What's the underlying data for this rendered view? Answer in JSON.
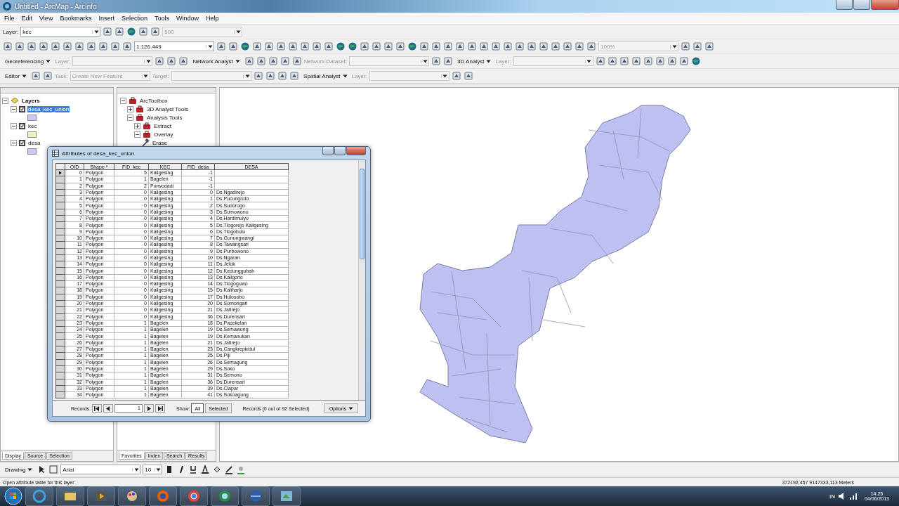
{
  "window": {
    "title": "Untitled - ArcMap - ArcInfo"
  },
  "menu": [
    "File",
    "Edit",
    "View",
    "Bookmarks",
    "Insert",
    "Selection",
    "Tools",
    "Window",
    "Help"
  ],
  "toolbars": [
    [
      {
        "kind": "label",
        "text": "Layer:",
        "disabled": false
      },
      {
        "kind": "combo",
        "text": "kec",
        "disabled": false
      },
      {
        "kind": "icon"
      },
      {
        "kind": "icon"
      },
      {
        "kind": "round"
      },
      {
        "kind": "icon"
      },
      {
        "kind": "icon"
      },
      {
        "kind": "combo",
        "text": "500",
        "disabled": true
      }
    ],
    [
      {
        "kind": "icon"
      },
      {
        "kind": "icon"
      },
      {
        "kind": "icon"
      },
      {
        "kind": "icon"
      },
      {
        "kind": "icon"
      },
      {
        "kind": "icon"
      },
      {
        "kind": "icon"
      },
      {
        "kind": "icon"
      },
      {
        "kind": "icon"
      },
      {
        "kind": "icon"
      },
      {
        "kind": "icon"
      },
      {
        "kind": "combo",
        "text": "1:126.449",
        "disabled": false
      },
      {
        "kind": "icon"
      },
      {
        "kind": "icon"
      },
      {
        "kind": "round"
      },
      {
        "kind": "icon"
      },
      {
        "kind": "icon"
      },
      {
        "kind": "icon"
      },
      {
        "kind": "icon"
      },
      {
        "kind": "icon"
      },
      {
        "kind": "icon"
      },
      {
        "kind": "icon"
      },
      {
        "kind": "round"
      },
      {
        "kind": "round"
      },
      {
        "kind": "icon"
      },
      {
        "kind": "icon"
      },
      {
        "kind": "icon"
      },
      {
        "kind": "icon"
      },
      {
        "kind": "round"
      },
      {
        "kind": "icon"
      },
      {
        "kind": "icon"
      },
      {
        "kind": "icon"
      },
      {
        "kind": "icon"
      },
      {
        "kind": "icon"
      },
      {
        "kind": "icon"
      },
      {
        "kind": "icon"
      },
      {
        "kind": "icon"
      },
      {
        "kind": "icon"
      },
      {
        "kind": "icon"
      },
      {
        "kind": "icon"
      },
      {
        "kind": "icon"
      },
      {
        "kind": "icon"
      },
      {
        "kind": "icon"
      },
      {
        "kind": "icon"
      },
      {
        "kind": "combo",
        "text": "100%",
        "disabled": true
      },
      {
        "kind": "icon"
      },
      {
        "kind": "icon"
      },
      {
        "kind": "icon"
      }
    ],
    [
      {
        "kind": "menu",
        "text": "Georeferencing",
        "disabled": false
      },
      {
        "kind": "label",
        "text": "Layer:",
        "disabled": true
      },
      {
        "kind": "combo",
        "disabled": true
      },
      {
        "kind": "icon"
      },
      {
        "kind": "icon"
      },
      {
        "kind": "icon"
      },
      {
        "kind": "menu",
        "text": "Network Analyst",
        "disabled": false
      },
      {
        "kind": "icon"
      },
      {
        "kind": "icon"
      },
      {
        "kind": "icon"
      },
      {
        "kind": "icon"
      },
      {
        "kind": "icon"
      },
      {
        "kind": "label",
        "text": "Network Dataset:",
        "disabled": true
      },
      {
        "kind": "combo",
        "disabled": true
      },
      {
        "kind": "icon"
      },
      {
        "kind": "icon"
      },
      {
        "kind": "menu",
        "text": "3D Analyst",
        "disabled": false
      },
      {
        "kind": "label",
        "text": "Layer:",
        "disabled": true
      },
      {
        "kind": "combo",
        "disabled": true
      },
      {
        "kind": "icon"
      },
      {
        "kind": "icon"
      },
      {
        "kind": "icon"
      },
      {
        "kind": "icon"
      },
      {
        "kind": "icon"
      },
      {
        "kind": "icon"
      },
      {
        "kind": "icon"
      },
      {
        "kind": "icon"
      },
      {
        "kind": "round"
      }
    ],
    [
      {
        "kind": "menu",
        "text": "Editor",
        "disabled": false
      },
      {
        "kind": "icon"
      },
      {
        "kind": "icon"
      },
      {
        "kind": "label",
        "text": "Task:",
        "disabled": true
      },
      {
        "kind": "combo",
        "text": "Create New Feature",
        "disabled": true
      },
      {
        "kind": "label",
        "text": "Target:",
        "disabled": true
      },
      {
        "kind": "combo",
        "disabled": true
      },
      {
        "kind": "icon"
      },
      {
        "kind": "icon"
      },
      {
        "kind": "icon"
      },
      {
        "kind": "icon"
      },
      {
        "kind": "menu",
        "text": "Spatial Analyst",
        "disabled": false
      },
      {
        "kind": "label",
        "text": "Layer:",
        "disabled": true
      },
      {
        "kind": "combo",
        "disabled": true
      },
      {
        "kind": "icon"
      },
      {
        "kind": "icon"
      }
    ]
  ],
  "toc": {
    "root": "Layers",
    "layers": [
      {
        "name": "desa_kec_union",
        "checked": true,
        "selected": true,
        "color": "#c8c8f0"
      },
      {
        "name": "kec",
        "checked": true,
        "selected": false,
        "color": "#f0f0c0"
      },
      {
        "name": "desa",
        "checked": true,
        "selected": false,
        "color": "#c8c8f0"
      }
    ],
    "tabs": [
      {
        "label": "Display",
        "selected": true
      },
      {
        "label": "Source",
        "selected": false
      },
      {
        "label": "Selection",
        "selected": false
      }
    ]
  },
  "toolbox": {
    "tree": [
      {
        "label": "ArcToolbox",
        "expanded": true,
        "children": [
          {
            "label": "3D Analyst Tools",
            "expanded": false
          },
          {
            "label": "Analysis Tools",
            "expanded": true,
            "children": [
              {
                "label": "Extract",
                "expanded": false
              },
              {
                "label": "Overlay",
                "expanded": true,
                "children": [
                  {
                    "label": "Erase"
                  }
                ]
              }
            ]
          }
        ]
      }
    ],
    "tabs": [
      {
        "label": "Favorites",
        "selected": true
      },
      {
        "label": "Index",
        "selected": false
      },
      {
        "label": "Search",
        "selected": false
      },
      {
        "label": "Results",
        "selected": false
      }
    ]
  },
  "attribute_table": {
    "title": "Attributes of desa_kec_union",
    "columns": [
      "OID",
      "Shape *",
      "FID_kec",
      "KEC",
      "FID_desa",
      "DESA"
    ],
    "rows": [
      {
        "current": true,
        "cells": [
          "0",
          "Polygon",
          "5",
          "Kaligesing",
          "-1",
          ""
        ]
      },
      {
        "current": false,
        "cells": [
          "1",
          "Polygon",
          "1",
          "Bagelen",
          "-1",
          ""
        ]
      },
      {
        "current": false,
        "cells": [
          "2",
          "Polygon",
          "2",
          "Purwodadi",
          "-1",
          ""
        ]
      },
      {
        "current": false,
        "cells": [
          "3",
          "Polygon",
          "0",
          "Kaligesing",
          "0",
          "Ds.Ngadirejo"
        ]
      },
      {
        "current": false,
        "cells": [
          "4",
          "Polygon",
          "0",
          "Kaligesing",
          "1",
          "Ds.Pucungroto"
        ]
      },
      {
        "current": false,
        "cells": [
          "5",
          "Polygon",
          "0",
          "Kaligesing",
          "2",
          "Ds.Sudorogo"
        ]
      },
      {
        "current": false,
        "cells": [
          "6",
          "Polygon",
          "0",
          "Kaligesing",
          "3",
          "Ds.Sumowono"
        ]
      },
      {
        "current": false,
        "cells": [
          "7",
          "Polygon",
          "0",
          "Kaligesing",
          "4",
          "Ds.Hardimulyo"
        ]
      },
      {
        "current": false,
        "cells": [
          "8",
          "Polygon",
          "0",
          "Kaligesing",
          "5",
          "Ds.Tlogorejo Kaligesing"
        ]
      },
      {
        "current": false,
        "cells": [
          "9",
          "Polygon",
          "0",
          "Kaligesing",
          "6",
          "Ds.Tlogobulu"
        ]
      },
      {
        "current": false,
        "cells": [
          "10",
          "Polygon",
          "0",
          "Kaligesing",
          "7",
          "Ds.Gunungwangi"
        ]
      },
      {
        "current": false,
        "cells": [
          "11",
          "Polygon",
          "0",
          "Kaligesing",
          "8",
          "Ds.Tawangsari"
        ]
      },
      {
        "current": false,
        "cells": [
          "12",
          "Polygon",
          "0",
          "Kaligesing",
          "9",
          "Ds.Purbowono"
        ]
      },
      {
        "current": false,
        "cells": [
          "13",
          "Polygon",
          "0",
          "Kaligesing",
          "10",
          "Ds.Ngaran"
        ]
      },
      {
        "current": false,
        "cells": [
          "14",
          "Polygon",
          "0",
          "Kaligesing",
          "11",
          "Ds.Jelok"
        ]
      },
      {
        "current": false,
        "cells": [
          "15",
          "Polygon",
          "0",
          "Kaligesing",
          "12",
          "Ds.Kedunggubah"
        ]
      },
      {
        "current": false,
        "cells": [
          "16",
          "Polygon",
          "0",
          "Kaligesing",
          "13",
          "Ds.Kaligono"
        ]
      },
      {
        "current": false,
        "cells": [
          "17",
          "Polygon",
          "0",
          "Kaligesing",
          "14",
          "Ds.Tlogoguwo"
        ]
      },
      {
        "current": false,
        "cells": [
          "18",
          "Polygon",
          "0",
          "Kaligesing",
          "15",
          "Ds.Kaliharjo"
        ]
      },
      {
        "current": false,
        "cells": [
          "19",
          "Polygon",
          "0",
          "Kaligesing",
          "17",
          "Ds.Hulosobo"
        ]
      },
      {
        "current": false,
        "cells": [
          "20",
          "Polygon",
          "0",
          "Kaligesing",
          "20",
          "Ds.Somongari"
        ]
      },
      {
        "current": false,
        "cells": [
          "21",
          "Polygon",
          "0",
          "Kaligesing",
          "21",
          "Ds.Jatirejo"
        ]
      },
      {
        "current": false,
        "cells": [
          "22",
          "Polygon",
          "0",
          "Kaligesing",
          "36",
          "Ds.Durensari"
        ]
      },
      {
        "current": false,
        "cells": [
          "23",
          "Polygon",
          "1",
          "Bagelen",
          "18",
          "Ds.Pacekelan"
        ]
      },
      {
        "current": false,
        "cells": [
          "24",
          "Polygon",
          "1",
          "Bagelen",
          "19",
          "Ds.Semawung"
        ]
      },
      {
        "current": false,
        "cells": [
          "25",
          "Polygon",
          "1",
          "Bagelen",
          "19",
          "Ds.Kemanukan"
        ]
      },
      {
        "current": false,
        "cells": [
          "26",
          "Polygon",
          "1",
          "Bagelen",
          "21",
          "Ds.Jatirejo"
        ]
      },
      {
        "current": false,
        "cells": [
          "27",
          "Polygon",
          "1",
          "Bagelen",
          "23",
          "Ds.Cangkrepkidul"
        ]
      },
      {
        "current": false,
        "cells": [
          "28",
          "Polygon",
          "1",
          "Bagelen",
          "25",
          "Ds.Piji"
        ]
      },
      {
        "current": false,
        "cells": [
          "29",
          "Polygon",
          "1",
          "Bagelen",
          "26",
          "Ds.Semagung"
        ]
      },
      {
        "current": false,
        "cells": [
          "30",
          "Polygon",
          "1",
          "Bagelen",
          "29",
          "Ds.Soko"
        ]
      },
      {
        "current": false,
        "cells": [
          "31",
          "Polygon",
          "1",
          "Bagelen",
          "31",
          "Ds.Semono"
        ]
      },
      {
        "current": false,
        "cells": [
          "32",
          "Polygon",
          "1",
          "Bagelen",
          "36",
          "Ds.Durensari"
        ]
      },
      {
        "current": false,
        "cells": [
          "33",
          "Polygon",
          "1",
          "Bagelen",
          "39",
          "Ds.Clapar"
        ]
      },
      {
        "current": false,
        "cells": [
          "34",
          "Polygon",
          "1",
          "Bagelen",
          "41",
          "Ds.Sokoagung"
        ]
      }
    ],
    "footer": {
      "records_label": "Records:",
      "record": "1",
      "show_label": "Show:",
      "show": [
        {
          "label": "All",
          "selected": true
        },
        {
          "label": "Selected",
          "selected": false
        }
      ],
      "status": "Records (0 out of 92 Selected)",
      "options": "Options"
    }
  },
  "drawing_toolbar": {
    "menu": "Drawing",
    "font": "Arial",
    "size": "10"
  },
  "status_bar": {
    "message": "Open attribute table for this layer",
    "coordinates": "372192,457  9147333,113 Meters"
  },
  "taskbar": {
    "language": "IN",
    "time": "14:25",
    "date": "04/06/2013"
  }
}
